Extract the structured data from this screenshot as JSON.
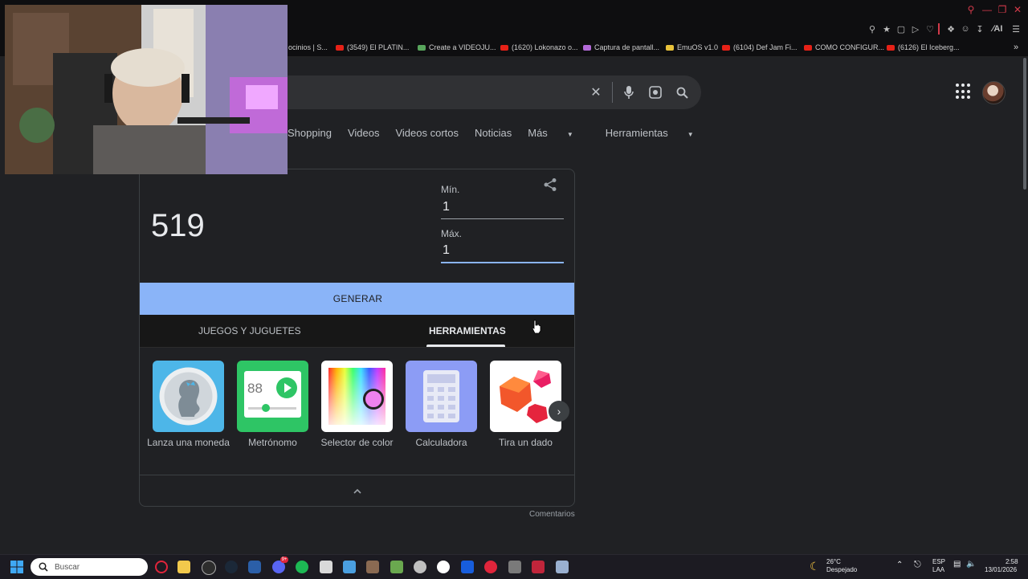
{
  "bookmarks": [
    {
      "label": "ocinios | S..."
    },
    {
      "label": "(3549) El PLATIN..."
    },
    {
      "label": "Create a VIDEOJU..."
    },
    {
      "label": "(1620) Lokonazo o..."
    },
    {
      "label": "Captura de pantall..."
    },
    {
      "label": "EmuOS v1.0"
    },
    {
      "label": "(6104) Def Jam Fi..."
    },
    {
      "label": "COMO CONFIGUR..."
    },
    {
      "label": "(6126) El Iceberg..."
    }
  ],
  "toolbar": {
    "ai_label": "AI"
  },
  "search_tabs": [
    {
      "label": "Shopping"
    },
    {
      "label": "Videos"
    },
    {
      "label": "Videos cortos"
    },
    {
      "label": "Noticias"
    },
    {
      "label": "Más"
    },
    {
      "label": "Herramientas"
    }
  ],
  "rng": {
    "result": "519",
    "min_label": "Mín.",
    "min_value": "1",
    "max_label": "Máx.",
    "max_value": "1",
    "generate_label": "GENERAR"
  },
  "category_tabs": [
    {
      "label": "JUEGOS Y JUGUETES"
    },
    {
      "label": "HERRAMIENTAS"
    }
  ],
  "tools": [
    {
      "label": "Lanza una moneda"
    },
    {
      "label": "Metrónomo",
      "display": "88"
    },
    {
      "label": "Selector de color"
    },
    {
      "label": "Calculadora"
    },
    {
      "label": "Tira un dado"
    }
  ],
  "footer": {
    "comments_label": "Comentarios"
  },
  "taskbar": {
    "search_placeholder": "Buscar",
    "weather_temp": "26°C",
    "weather_desc": "Despejado",
    "lang_top": "ESP",
    "lang_bottom": "LAA",
    "time": "2:58",
    "date": "13/01/2026",
    "discord_badge": "9+"
  },
  "colors": {
    "accent": "#8ab4f8",
    "page_bg": "#202124",
    "browser_accent": "#d23a4a"
  }
}
